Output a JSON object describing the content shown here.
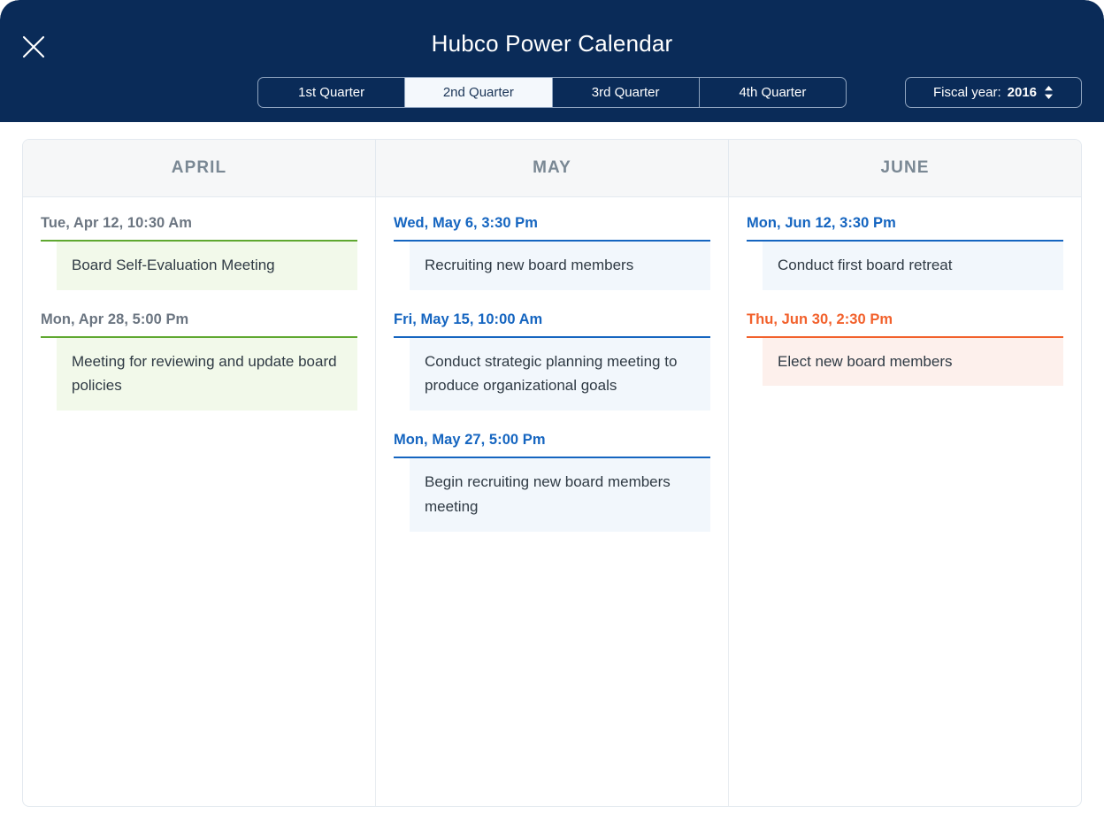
{
  "header": {
    "title": "Hubco Power Calendar",
    "close_icon": "close-icon",
    "quarters": [
      {
        "label": "1st Quarter",
        "active": false
      },
      {
        "label": "2nd Quarter",
        "active": true
      },
      {
        "label": "3rd Quarter",
        "active": false
      },
      {
        "label": "4th Quarter",
        "active": false
      }
    ],
    "fiscal_year": {
      "label": "Fiscal year:",
      "value": "2016",
      "stepper_icon": "up-down-chevron-icon"
    },
    "colors": {
      "background": "#0A2B58",
      "active_segment_bg": "#F4F8FC",
      "text": "#FFFFFF"
    }
  },
  "calendar": {
    "months": [
      {
        "name": "APRIL",
        "events": [
          {
            "date": "Tue, Apr 12, 10:30 Am",
            "title": "Board Self-Evaluation Meeting",
            "accent": "green"
          },
          {
            "date": "Mon, Apr 28, 5:00 Pm",
            "title": "Meeting for reviewing and update board policies",
            "accent": "green"
          }
        ]
      },
      {
        "name": "MAY",
        "events": [
          {
            "date": "Wed, May 6, 3:30 Pm",
            "title": "Recruiting new board members",
            "accent": "blue"
          },
          {
            "date": "Fri, May 15, 10:00 Am",
            "title": "Conduct strategic planning meeting to produce organizational goals",
            "accent": "blue"
          },
          {
            "date": "Mon, May 27, 5:00 Pm",
            "title": "Begin recruiting new board members meeting",
            "accent": "blue"
          }
        ]
      },
      {
        "name": "JUNE",
        "events": [
          {
            "date": "Mon, Jun 12, 3:30 Pm",
            "title": "Conduct first board retreat",
            "accent": "blue"
          },
          {
            "date": "Thu, Jun 30, 2:30 Pm",
            "title": "Elect new board members",
            "accent": "orange"
          }
        ]
      }
    ],
    "accent_colors": {
      "green": "#5FA830",
      "green_bg": "#F2F9EA",
      "blue": "#1565C0",
      "blue_bg": "#F2F7FC",
      "orange": "#F2612C",
      "orange_bg": "#FDF0EC",
      "month_header_text": "#7A8894",
      "month_header_bg": "#F6F7F8"
    }
  }
}
